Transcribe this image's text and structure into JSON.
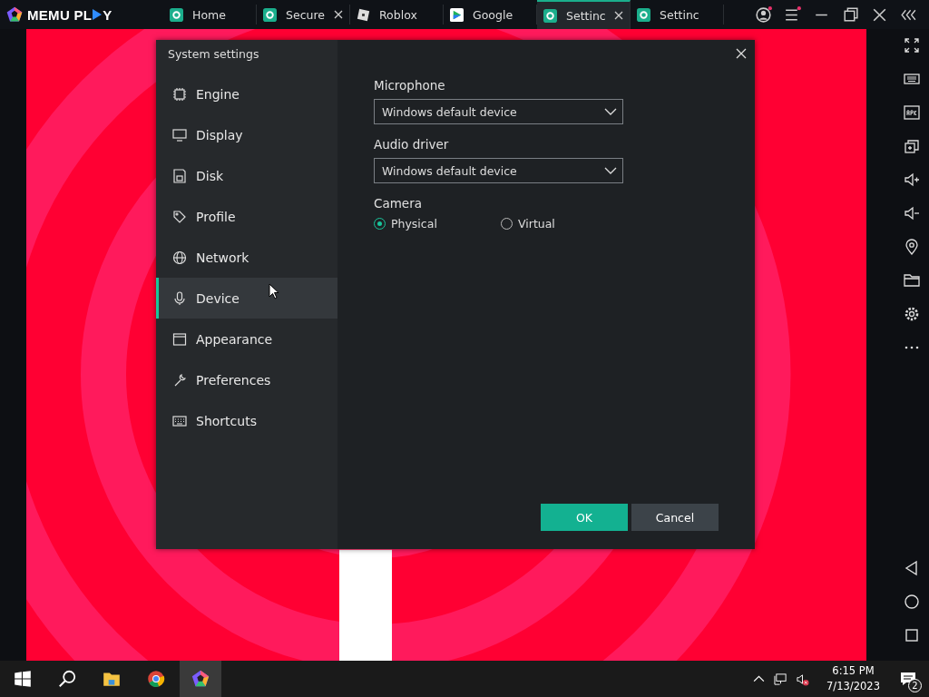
{
  "logo": {
    "before": "MEMU PL",
    "after": "Y"
  },
  "tabs": [
    {
      "label": "Home",
      "selected": false,
      "closable": false
    },
    {
      "label": "Secure",
      "selected": false,
      "closable": true
    },
    {
      "label": "Roblox",
      "selected": false,
      "closable": false
    },
    {
      "label": "Google",
      "selected": false,
      "closable": false
    },
    {
      "label": "Settinc",
      "selected": true,
      "closable": true
    },
    {
      "label": "Settinc",
      "selected": false,
      "closable": false
    }
  ],
  "dialog": {
    "title": "System settings",
    "sidebar": {
      "items": [
        {
          "label": "Engine",
          "selected": false
        },
        {
          "label": "Display",
          "selected": false
        },
        {
          "label": "Disk",
          "selected": false
        },
        {
          "label": "Profile",
          "selected": false
        },
        {
          "label": "Network",
          "selected": false
        },
        {
          "label": "Device",
          "selected": true
        },
        {
          "label": "Appearance",
          "selected": false
        },
        {
          "label": "Preferences",
          "selected": false
        },
        {
          "label": "Shortcuts",
          "selected": false
        }
      ]
    },
    "fields": [
      {
        "label": "Microphone",
        "value": "Windows default device"
      },
      {
        "label": "Audio driver",
        "value": "Windows default device"
      }
    ],
    "camera": {
      "label": "Camera",
      "options": [
        {
          "label": "Physical",
          "selected": true
        },
        {
          "label": "Virtual",
          "selected": false
        }
      ]
    },
    "buttons": [
      {
        "label": "OK",
        "kind": "primary"
      },
      {
        "label": "Cancel",
        "kind": "secondary"
      }
    ]
  },
  "taskbar": {
    "time": "6:15 PM",
    "date": "7/13/2023",
    "notifications": "2"
  }
}
